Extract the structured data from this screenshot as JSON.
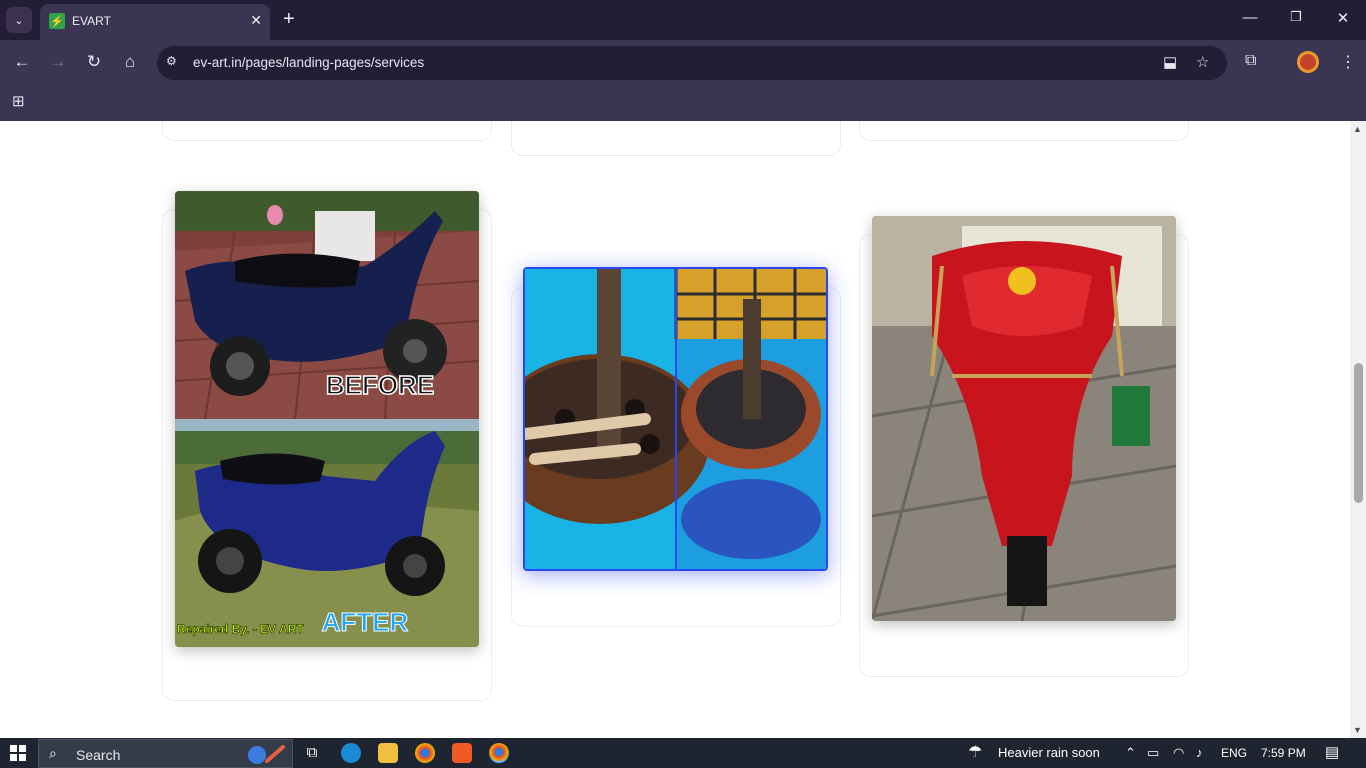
{
  "browser": {
    "tab": {
      "title": "EVART",
      "favicon": "evart-logo-icon"
    },
    "new_tab_symbol": "+",
    "tab_close_symbol": "✕",
    "window": {
      "minimize": "—",
      "restore": "❐",
      "close": "✕"
    },
    "nav": {
      "back": "←",
      "forward": "→",
      "reload": "↻",
      "home": "⌂"
    },
    "url": "ev-art.in/pages/landing-pages/services",
    "omnibox_icons": [
      "install-app-icon",
      "bookmark-star-icon"
    ],
    "toolbar_icons": [
      "extensions-icon",
      "profile-avatar-icon",
      "more-menu-icon"
    ]
  },
  "page": {
    "cards": [
      {
        "image": "scooter-before-after-photo",
        "overlay_before": "BEFORE",
        "overlay_after": "AFTER",
        "overlay_credit": "Repaired By. - EV ART"
      },
      {
        "image": "motor-stator-rewinding-photo"
      },
      {
        "image": "red-scooter-photo"
      }
    ]
  },
  "taskbar": {
    "search_placeholder": "Search",
    "weather": "Heavier rain soon",
    "language": "ENG",
    "time": "7:59 PM",
    "apps": [
      "task-view-icon",
      "edge-icon",
      "file-explorer-icon",
      "chrome-icon",
      "brave-icon",
      "chrome-active-icon"
    ]
  }
}
